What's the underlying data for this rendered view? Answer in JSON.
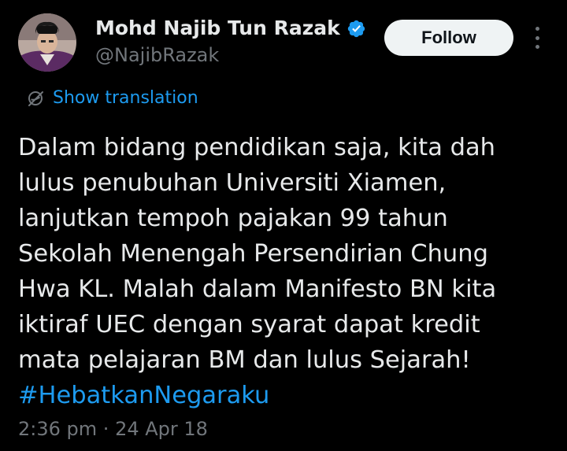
{
  "author": {
    "name": "Mohd Najib Tun Razak",
    "handle": "@NajibRazak",
    "verified_color": "#1d9bf0"
  },
  "actions": {
    "follow_label": "Follow",
    "more_icon": "more-vertical-icon"
  },
  "translation": {
    "label": "Show translation",
    "icon": "globe-slash-icon"
  },
  "tweet": {
    "lines": [
      "Dalam bidang pendidikan saja, kita dah",
      "lulus penubuhan Universiti Xiamen,",
      "lanjutkan tempoh pajakan 99 tahun",
      "Sekolah Menengah Persendirian Chung",
      "Hwa KL. Malah dalam Manifesto BN kita",
      "iktiraf UEC dengan syarat dapat kredit",
      "mata pelajaran BM dan lulus Sejarah!"
    ],
    "hashtag": "#HebatkanNegaraku",
    "time": "2:36 pm",
    "separator": "·",
    "date": "24 Apr 18"
  },
  "colors": {
    "background": "#000000",
    "text": "#e7e9ea",
    "secondary": "#71767b",
    "link": "#1d9bf0",
    "button_bg": "#eff3f4"
  }
}
